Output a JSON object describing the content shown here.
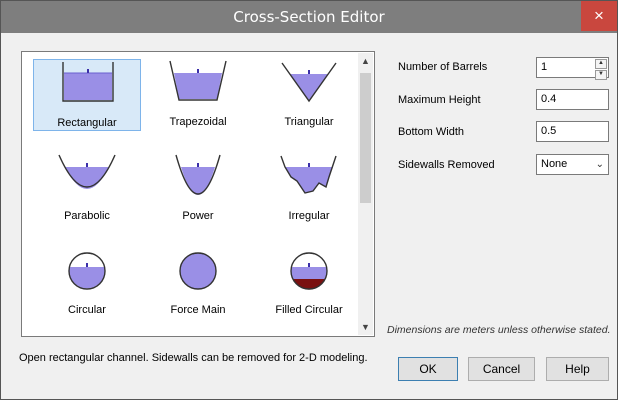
{
  "window": {
    "title": "Cross-Section Editor",
    "close_glyph": "×"
  },
  "shapes": [
    {
      "label": "Rectangular",
      "icon": "rectangular-channel-icon",
      "selected": true
    },
    {
      "label": "Trapezoidal",
      "icon": "trapezoidal-channel-icon"
    },
    {
      "label": "Triangular",
      "icon": "triangular-channel-icon"
    },
    {
      "label": "Parabolic",
      "icon": "parabolic-channel-icon"
    },
    {
      "label": "Power",
      "icon": "power-channel-icon"
    },
    {
      "label": "Irregular",
      "icon": "irregular-channel-icon"
    },
    {
      "label": "Circular",
      "icon": "circular-conduit-icon"
    },
    {
      "label": "Force Main",
      "icon": "force-main-icon"
    },
    {
      "label": "Filled Circular",
      "icon": "filled-circular-icon"
    }
  ],
  "properties": {
    "barrels_label": "Number of Barrels",
    "barrels_value": "1",
    "max_height_label": "Maximum Height",
    "max_height_value": "0.4",
    "bottom_width_label": "Bottom Width",
    "bottom_width_value": "0.5",
    "sidewalls_label": "Sidewalls Removed",
    "sidewalls_value": "None"
  },
  "note": "Dimensions are meters unless otherwise stated.",
  "description": "Open rectangular channel. Sidewalls can be removed for 2-D modeling.",
  "buttons": {
    "ok": "OK",
    "cancel": "Cancel",
    "help": "Help"
  },
  "colors": {
    "water": "#9a8fe6",
    "water_outline": "#6a5fcf",
    "sediment": "#7a1010",
    "selection": "#d8e9f8",
    "titlebar": "#7e7e7e",
    "close": "#c9473e"
  }
}
